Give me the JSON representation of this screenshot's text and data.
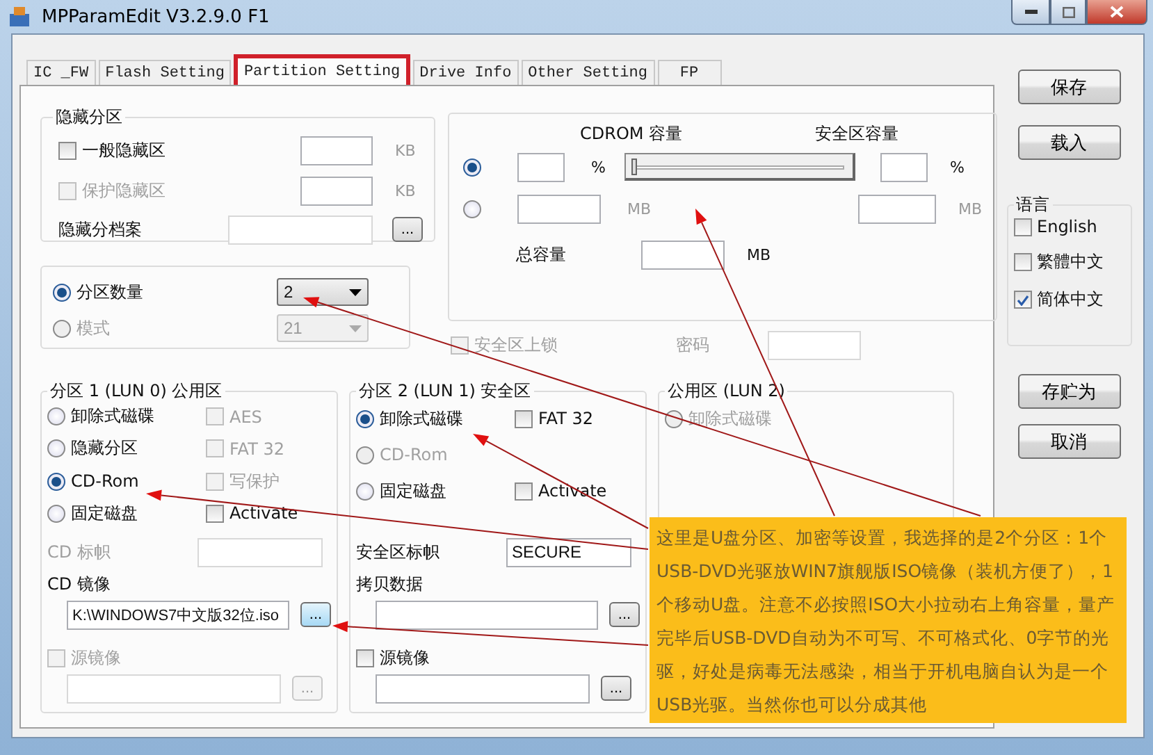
{
  "window": {
    "title": "MPParamEdit V3.2.9.0 F1"
  },
  "tabs": [
    {
      "label": "IC _FW",
      "selected": false,
      "highlighted": false
    },
    {
      "label": "Flash Setting",
      "selected": false,
      "highlighted": false
    },
    {
      "label": "Partition Setting",
      "selected": true,
      "highlighted": true
    },
    {
      "label": "Drive Info",
      "selected": false,
      "highlighted": false
    },
    {
      "label": "Other Setting",
      "selected": false,
      "highlighted": false
    },
    {
      "label": "FP",
      "selected": false,
      "highlighted": false
    }
  ],
  "hidden_partition": {
    "title": "隐藏分区",
    "rows": [
      {
        "kind": "checkbox",
        "label": "一般隐藏区",
        "checked": false,
        "disabled": false,
        "unit": "KB"
      },
      {
        "kind": "checkbox",
        "label": "保护隐藏区",
        "checked": false,
        "disabled": true,
        "unit": "KB"
      },
      {
        "kind": "file",
        "label": "隐藏分档案",
        "browse": "..."
      }
    ]
  },
  "capacity": {
    "cdrom_label": "CDROM 容量",
    "secure_label": "安全区容量",
    "level": 0,
    "options": [
      {
        "selected": true,
        "unit": "%",
        "secure_unit": "%"
      },
      {
        "selected": false,
        "unit": "MB",
        "secure_unit": "MB"
      }
    ],
    "total_label": "总容量",
    "total_unit": "MB"
  },
  "partition_mode": [
    {
      "label": "分区数量",
      "selected": true,
      "value": "2",
      "disabled": false
    },
    {
      "label": "模式",
      "selected": false,
      "value": "21",
      "disabled": true
    }
  ],
  "lock": {
    "label": "安全区上锁",
    "checked": false,
    "disabled": true
  },
  "password": {
    "label": "密码",
    "disabled": true
  },
  "partitions": [
    {
      "title": "分区 1 (LUN 0) 公用区",
      "rows": [
        {
          "radio": {
            "label": "卸除式磁碟",
            "selected": false,
            "disabled": false
          },
          "check": {
            "label": "AES",
            "checked": false,
            "disabled": true
          }
        },
        {
          "radio": {
            "label": "隐藏分区",
            "selected": false,
            "disabled": false
          },
          "check": {
            "label": "FAT 32",
            "checked": false,
            "disabled": true
          }
        },
        {
          "radio": {
            "label": "CD-Rom",
            "selected": true,
            "disabled": false
          },
          "check": {
            "label": "写保护",
            "checked": false,
            "disabled": true
          }
        },
        {
          "radio": {
            "label": "固定磁盘",
            "selected": false,
            "disabled": false
          },
          "check": {
            "label": "Activate",
            "checked": false,
            "disabled": false
          }
        }
      ],
      "fields": [
        {
          "kind": "labeled",
          "label": "CD 标帜",
          "disabled": true
        },
        {
          "kind": "file",
          "label": "CD 镜像",
          "value": "K:\\WINDOWS7中文版32位.iso",
          "browse": "...",
          "disabled": false
        },
        {
          "kind": "source",
          "label": "源镜像",
          "checked": false,
          "disabled": true,
          "browse": "..."
        }
      ]
    },
    {
      "title": "分区 2 (LUN 1) 安全区",
      "rows": [
        {
          "radio": {
            "label": "卸除式磁碟",
            "selected": true,
            "disabled": false
          },
          "check": {
            "label": "FAT 32",
            "checked": false,
            "disabled": false
          }
        },
        {
          "radio": {
            "label": "CD-Rom",
            "selected": false,
            "disabled": true
          }
        },
        {
          "radio": {
            "label": "固定磁盘",
            "selected": false,
            "disabled": false
          },
          "check": {
            "label": "Activate",
            "checked": false,
            "disabled": false
          }
        }
      ],
      "fields": [
        {
          "kind": "labeled",
          "label": "安全区标帜",
          "value": "SECURE",
          "disabled": false
        },
        {
          "kind": "file",
          "label": "拷贝数据",
          "browse": "...",
          "disabled": false
        },
        {
          "kind": "source",
          "label": "源镜像",
          "checked": false,
          "disabled": false,
          "browse": "..."
        }
      ]
    },
    {
      "title": "公用区 (LUN 2)",
      "rows": [
        {
          "radio": {
            "label": "卸除式磁碟",
            "selected": false,
            "disabled": true
          }
        }
      ]
    }
  ],
  "actions_top": [
    "保存",
    "载入"
  ],
  "language": {
    "title": "语言",
    "options": [
      {
        "label": "English",
        "checked": false
      },
      {
        "label": "繁體中文",
        "checked": false
      },
      {
        "label": "简体中文",
        "checked": true
      }
    ]
  },
  "actions_bottom": [
    "存贮为",
    "取消"
  ],
  "annotation": {
    "text": "这里是U盘分区、加密等设置，我选择的是2个分区：1个USB-DVD光驱放WIN7旗舰版ISO镜像（装机方便了），1个移动U盘。注意不必按照ISO大小拉动右上角容量，量产完毕后USB-DVD自动为不可写、不可格式化、0字节的光驱，好处是病毒无法感染，相当于开机电脑自认为是一个USB光驱。当然你也可以分成其他"
  }
}
